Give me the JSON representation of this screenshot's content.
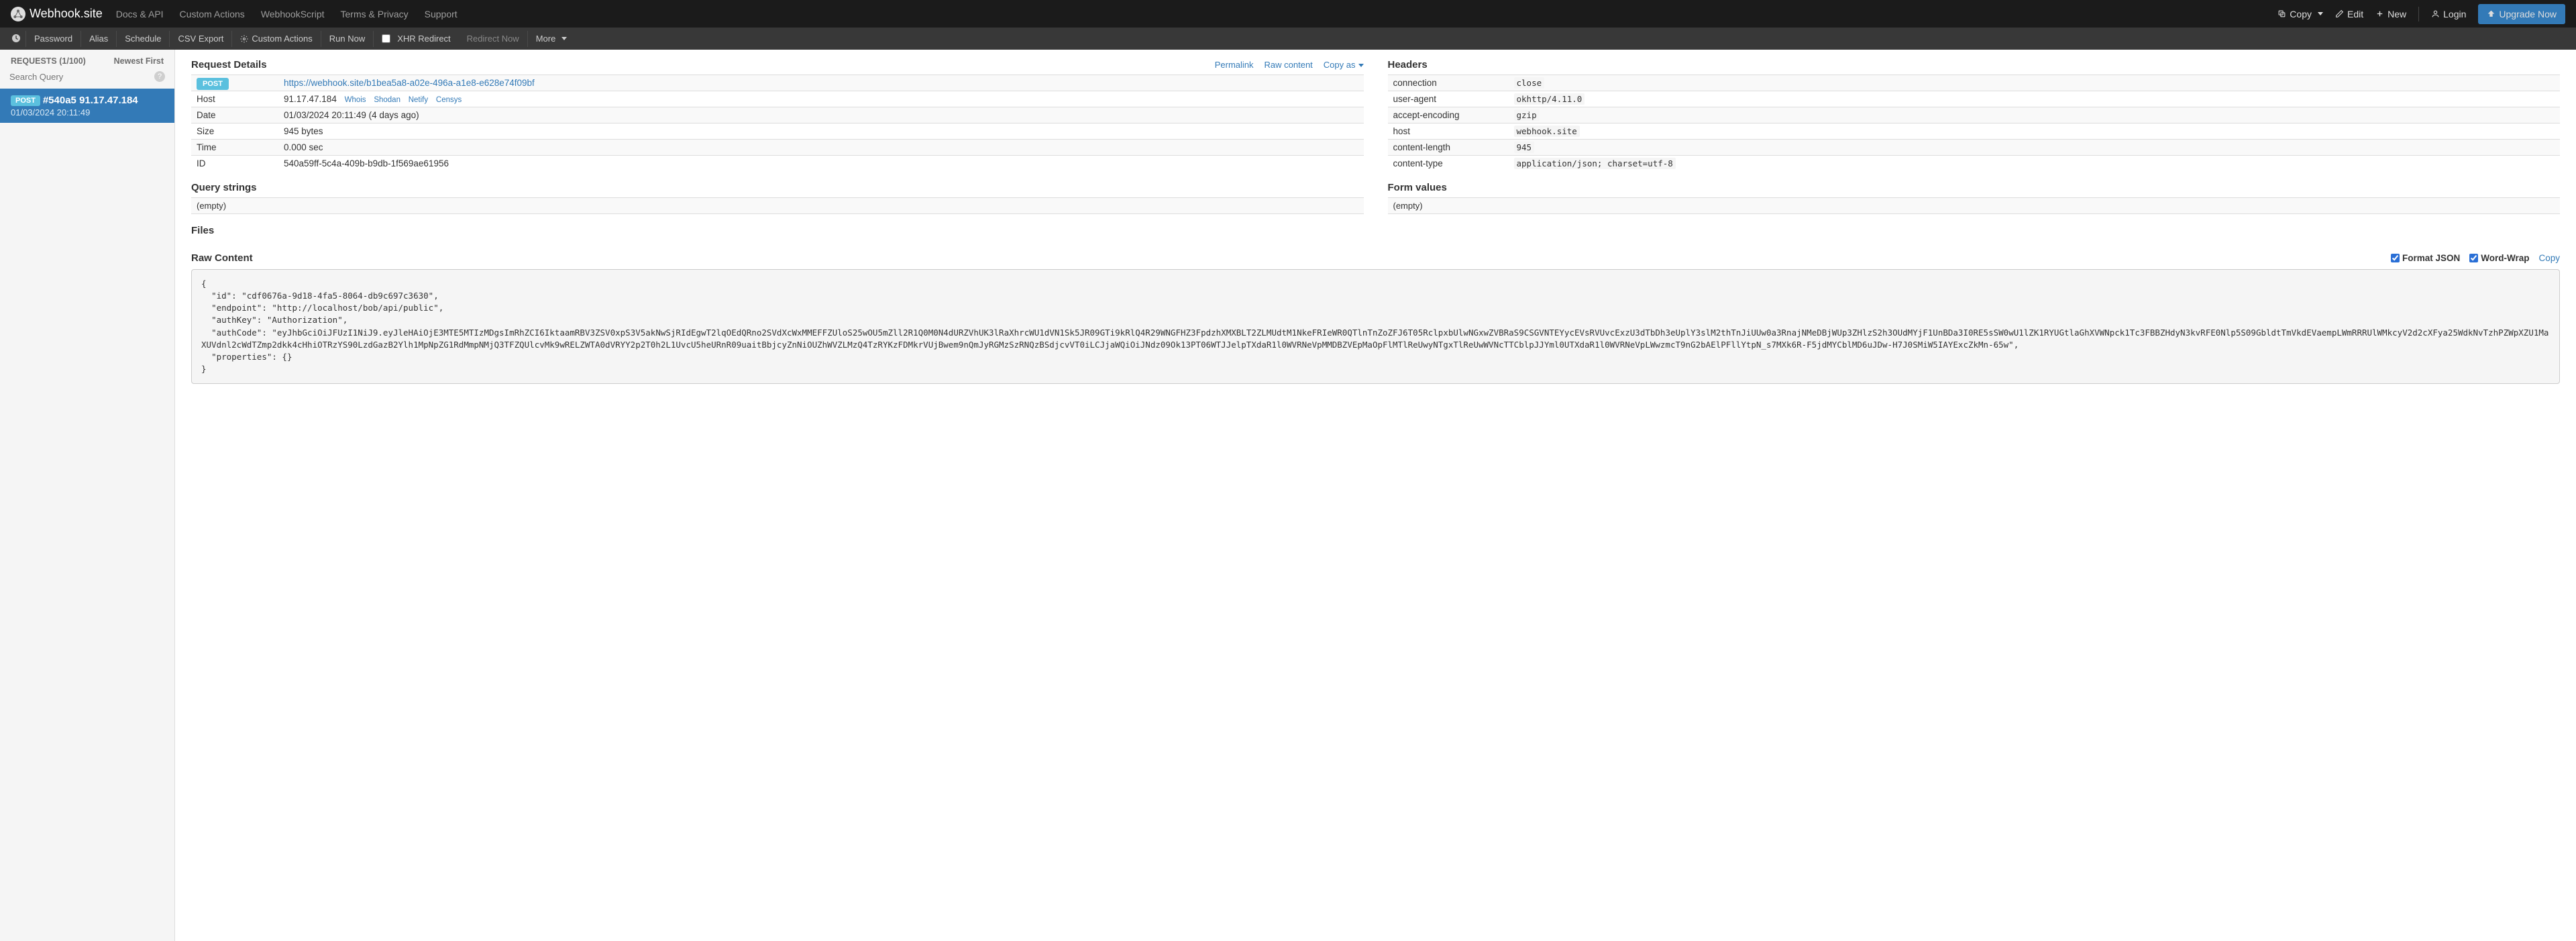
{
  "brand": "Webhook.site",
  "topnav": {
    "docs": "Docs & API",
    "custom_actions": "Custom Actions",
    "webhookscript": "WebhookScript",
    "terms": "Terms & Privacy",
    "support": "Support"
  },
  "topnav_right": {
    "copy": "Copy",
    "edit": "Edit",
    "new": "New",
    "login": "Login",
    "upgrade": "Upgrade Now"
  },
  "subnav": {
    "password": "Password",
    "alias": "Alias",
    "schedule": "Schedule",
    "csv_export": "CSV Export",
    "custom_actions": "Custom Actions",
    "run_now": "Run Now",
    "xhr_redirect": "XHR Redirect",
    "redirect_now": "Redirect Now",
    "more": "More"
  },
  "sidebar": {
    "requests_header": "REQUESTS (1/100)",
    "newest_first": "Newest First",
    "search_placeholder": "Search Query",
    "selected": {
      "method": "POST",
      "title": "#540a5 91.17.47.184",
      "time": "01/03/2024 20:11:49"
    }
  },
  "details": {
    "title": "Request Details",
    "links": {
      "permalink": "Permalink",
      "raw_content": "Raw content",
      "copy_as": "Copy as"
    },
    "method": "POST",
    "url": "https://webhook.site/b1bea5a8-a02e-496a-a1e8-e628e74f09bf",
    "host_label": "Host",
    "host_value": "91.17.47.184",
    "host_tools": {
      "whois": "Whois",
      "shodan": "Shodan",
      "netify": "Netify",
      "censys": "Censys"
    },
    "date_label": "Date",
    "date_value": "01/03/2024 20:11:49 (4 days ago)",
    "size_label": "Size",
    "size_value": "945 bytes",
    "time_label": "Time",
    "time_value": "0.000 sec",
    "id_label": "ID",
    "id_value": "540a59ff-5c4a-409b-b9db-1f569ae61956"
  },
  "query_strings": {
    "title": "Query strings",
    "empty": "(empty)"
  },
  "form_values": {
    "title": "Form values",
    "empty": "(empty)"
  },
  "files": {
    "title": "Files"
  },
  "headers": {
    "title": "Headers",
    "rows": [
      {
        "k": "connection",
        "v": "close"
      },
      {
        "k": "user-agent",
        "v": "okhttp/4.11.0"
      },
      {
        "k": "accept-encoding",
        "v": "gzip"
      },
      {
        "k": "host",
        "v": "webhook.site"
      },
      {
        "k": "content-length",
        "v": "945"
      },
      {
        "k": "content-type",
        "v": "application/json; charset=utf-8"
      }
    ]
  },
  "raw": {
    "title": "Raw Content",
    "format_json": "Format JSON",
    "word_wrap": "Word-Wrap",
    "copy": "Copy",
    "body": "{\n  \"id\": \"cdf0676a-9d18-4fa5-8064-db9c697c3630\",\n  \"endpoint\": \"http://localhost/bob/api/public\",\n  \"authKey\": \"Authorization\",\n  \"authCode\": \"eyJhbGciOiJFUzI1NiJ9.eyJleHAiOjE3MTE5MTIzMDgsImRhZCI6IktaamRBV3ZSV0xpS3V5akNwSjRIdEgwT2lqOEdQRno2SVdXcWxMMEFFZUloS25wOU5mZll2R1Q0M0N4dURZVhUK3lRaXhrcWU1dVN1Sk5JR09GTi9kRlQ4R29WNGFHZ3FpdzhXMXBLT2ZLMUdtM1NkeFRIeWR0QTlnTnZoZFJ6T05RclpxbUlwNGxwZVBRaS9CSGVNTEYycEVsRVUvcExzU3dTbDh3eUplY3slM2thTnJiUUw0a3RnajNMeDBjWUp3ZHlzS2h3OUdMYjF1UnBDa3I0RE5sSW0wU1lZK1RYUGtlaGhXVWNpck1Tc3FBBZHdyN3kvRFE0Nlp5S09GbldtTmVkdEVaempLWmRRRUlWMkcyV2d2cXFya25WdkNvTzhPZWpXZU1MaXUVdnl2cWdTZmp2dkk4cHhiOTRzYS90LzdGazB2Ylh1MpNpZG1RdMmpNMjQ3TFZQUlcvMk9wRELZWTA0dVRYY2p2T0h2L1UvcU5heURnR09uaitBbjcyZnNiOUZhWVZLMzQ4TzRYKzFDMkrVUjBwem9nQmJyRGMzSzRNQzBSdjcvVT0iLCJjaWQiOiJNdz09Ok13PT06WTJJelpTXdaR1l0WVRNeVpMMDBZVEpMaOpFlMTlReUwyNTgxTlReUwWVNcTTCblpJJYml0UTXdaR1l0WVRNeVpLWwzmcT9nG2bAElPFllYtpN_s7MXk6R-F5jdMYCblMD6uJDw-H7J0SMiW5IAYExcZkMn-65w\",\n  \"properties\": {}\n}"
  }
}
